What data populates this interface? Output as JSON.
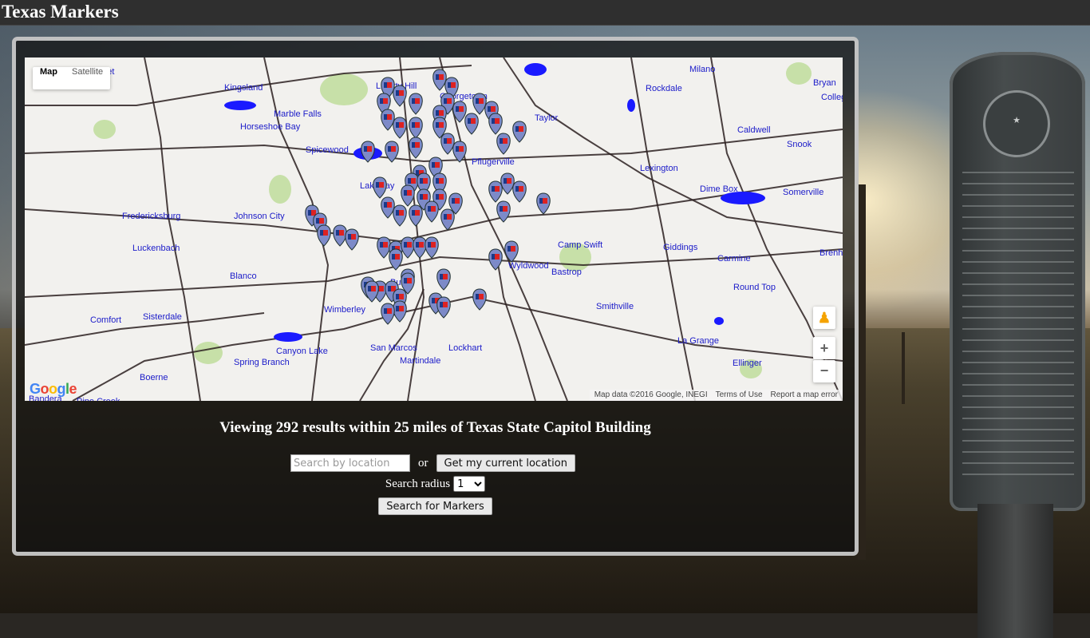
{
  "site": {
    "title": "Texas Markers"
  },
  "map": {
    "type_controls": {
      "map_label": "Map",
      "satellite_label": "Satellite",
      "active": "Map"
    },
    "google_logo": "Google",
    "attribution": {
      "data": "Map data ©2016 Google, INEGI",
      "terms": "Terms of Use",
      "report": "Report a map error"
    },
    "place_labels": [
      "Kingsland",
      "Marble Falls",
      "Horseshoe Bay",
      "Spicewood",
      "Lakeway",
      "Johnson City",
      "Fredericksburg",
      "Luckenbach",
      "Blanco",
      "Wimberley",
      "Comfort",
      "Sisterdale",
      "Spring Branch",
      "Canyon Lake",
      "Boerne",
      "San Marcos",
      "Martindale",
      "Lockhart",
      "Kyle",
      "Buda",
      "Bastrop",
      "Wyldwood",
      "Camp Swift",
      "Smithville",
      "Giddings",
      "Lexington",
      "Dime Box",
      "Caldwell",
      "Snook",
      "Rockdale",
      "Milano",
      "Taylor",
      "Somerville",
      "Brenham",
      "Carmine",
      "Round Top",
      "La Grange",
      "Ellinger",
      "Liberty Hill",
      "Georgetown",
      "Pflugerville",
      "Bryan",
      "College Station",
      "Burnet",
      "Bandera",
      "Pipe Creek"
    ],
    "marker_count": 292,
    "colors": {
      "water": "#1a1aff",
      "park": "#c7e0a8",
      "road": "#2b2020",
      "label": "#1b1bc9"
    }
  },
  "results": {
    "text": "Viewing 292 results within 25 miles of Texas State Capitol Building"
  },
  "search": {
    "location_placeholder": "Search by location",
    "location_value": "",
    "or_label": "or",
    "current_location_button": "Get my current location",
    "radius_label": "Search radius",
    "radius_value": "1",
    "submit_button": "Search for Markers"
  }
}
